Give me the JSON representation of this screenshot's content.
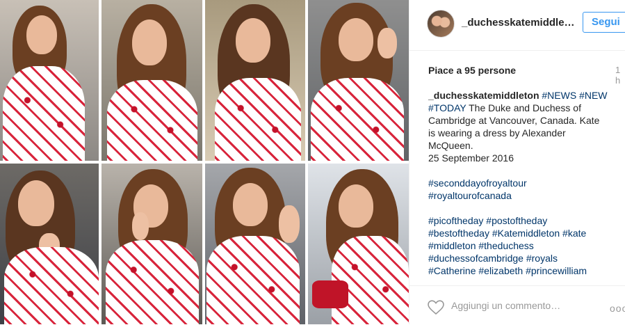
{
  "post": {
    "username": "_duchesskatemiddle…",
    "follow_label": "Segui",
    "likes": "Piace a 95 persone",
    "time": "1 h",
    "caption": {
      "user": "_duchesskatemiddleton",
      "lines": [
        {
          "text": "#NEWS #NEW",
          "tag": true
        },
        {
          "text": "#TODAY",
          "tag": true
        },
        {
          "text": "The Duke and Duchess of",
          "tag": false
        },
        {
          "text": "Cambridge at Vancouver, Canada. Kate",
          "tag": false
        },
        {
          "text": "is wearing a dress by Alexander",
          "tag": false
        },
        {
          "text": "McQueen.",
          "tag": false
        },
        {
          "text": "25 September 2016",
          "tag": false
        },
        {
          "text": "#seconddayofroyaltour",
          "tag": true
        },
        {
          "text": "#royaltourofcanada",
          "tag": true
        },
        {
          "text": "#picoftheday #postoftheday",
          "tag": true
        },
        {
          "text": "#bestoftheday #Katemiddleton #kate",
          "tag": true
        },
        {
          "text": "#middleton #theduchess",
          "tag": true
        },
        {
          "text": "#duchessofcambridge #royals",
          "tag": true
        },
        {
          "text": "#Catherine #elizabeth #princewilliam",
          "tag": true
        }
      ]
    },
    "comment_placeholder": "Aggiungi un commento…",
    "more_label": "ooo"
  },
  "icons": {
    "avatar": "profile-avatar",
    "heart": "heart-icon",
    "more": "more-options-icon"
  },
  "colors": {
    "accent": "#3897f0",
    "hashtag": "#003569",
    "dress_red": "#c4122a"
  }
}
